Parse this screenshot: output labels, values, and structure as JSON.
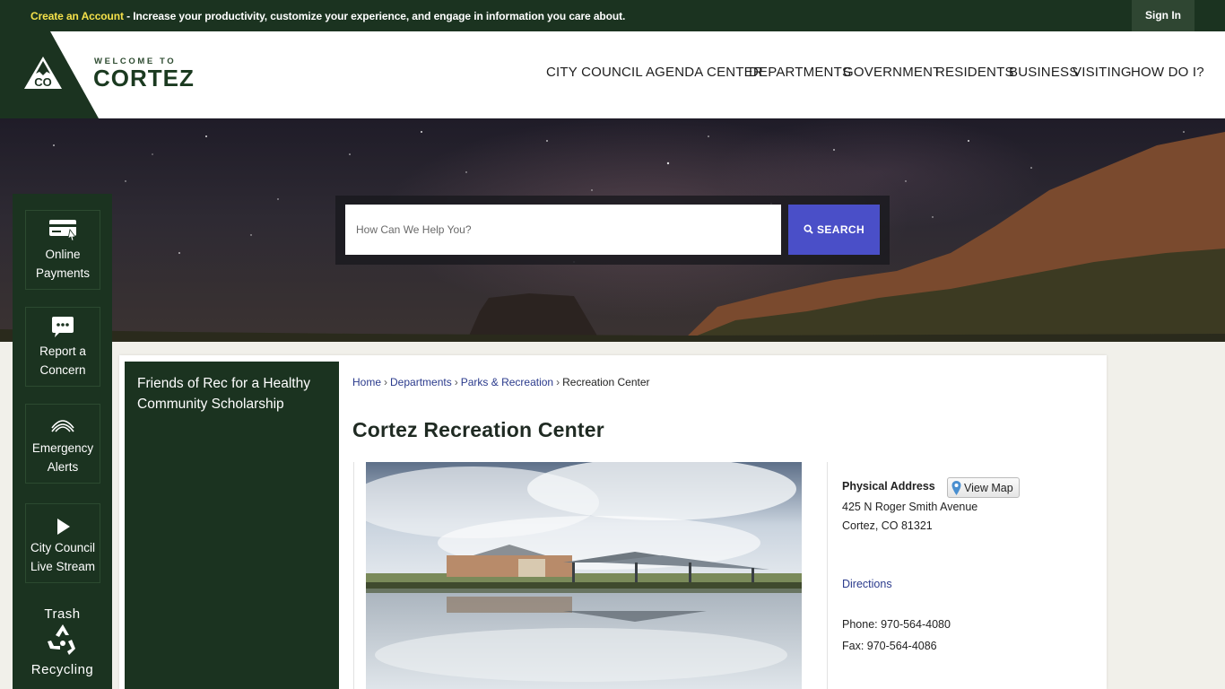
{
  "topbar": {
    "create_account": "Create an Account",
    "message": " - Increase your productivity, customize your experience, and engage in information you care about.",
    "sign_in": "Sign In"
  },
  "header": {
    "logo_mark": "CO",
    "welcome": "WELCOME TO",
    "city": "CORTEZ",
    "nav": [
      {
        "label": "CITY COUNCIL AGENDA CENTER"
      },
      {
        "label": "DEPARTMENTS"
      },
      {
        "label": "GOVERNMENT"
      },
      {
        "label": "RESIDENTS"
      },
      {
        "label": "BUSINESS"
      },
      {
        "label": "VISITING"
      },
      {
        "label": "HOW DO I?"
      }
    ]
  },
  "search": {
    "placeholder": "How Can We Help You?",
    "button_label": "SEARCH",
    "icon": "search-icon"
  },
  "quicklinks": [
    {
      "line1": "Online",
      "line2": "Payments",
      "icon": "credit-card-icon"
    },
    {
      "line1": "Report a",
      "line2": "Concern",
      "icon": "chat-bubble-icon"
    },
    {
      "line1": "Emergency",
      "line2": "Alerts",
      "icon": "alert-waves-icon"
    },
    {
      "line1": "City Council",
      "line2": "Live Stream",
      "icon": "play-icon"
    }
  ],
  "trash": {
    "line1": "Trash",
    "line2": "Recycling",
    "icon": "recycle-icon"
  },
  "sidenav": {
    "item": "Friends of Rec for a Healthy Community Scholarship"
  },
  "breadcrumb": {
    "home": "Home",
    "departments": "Departments",
    "parks": "Parks & Recreation",
    "current": "Recreation Center",
    "sep": "›"
  },
  "page": {
    "title": "Cortez Recreation Center"
  },
  "info": {
    "physical_address_label": "Physical Address",
    "view_map": "View Map",
    "address1": "425 N Roger Smith Avenue",
    "address2": "Cortez, CO 81321",
    "directions": "Directions",
    "phone": "Phone: 970-564-4080",
    "fax": "Fax: 970-564-4086"
  },
  "colors": {
    "brand_green": "#1b3320",
    "accent_yellow": "#f5e14a",
    "search_blue": "#4a4fc8",
    "link_blue": "#2a3a8c"
  }
}
